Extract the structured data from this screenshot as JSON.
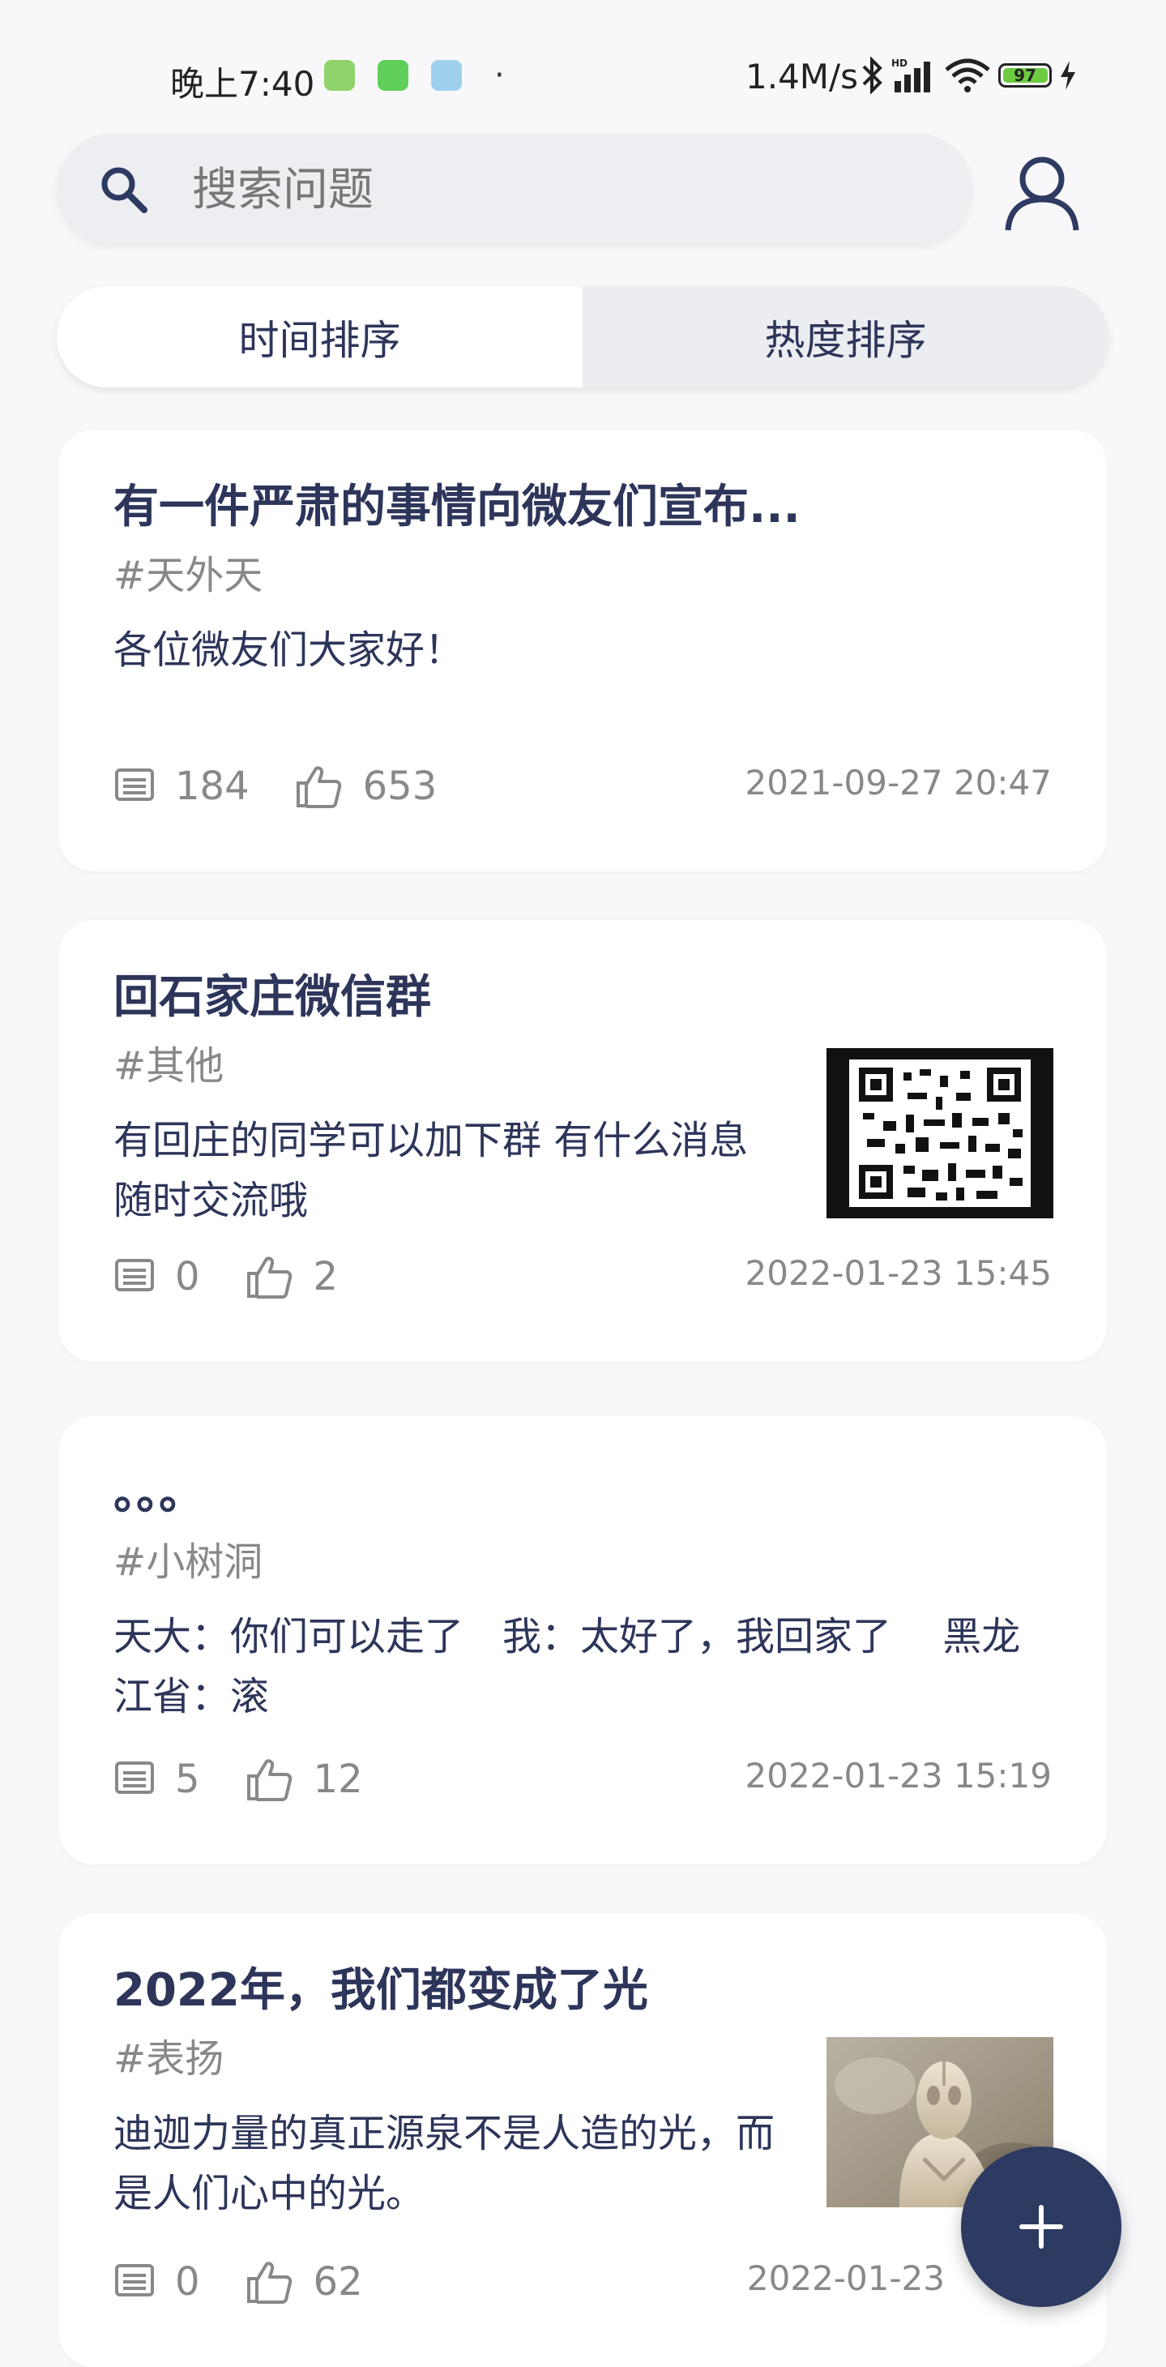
{
  "status_bar": {
    "time": "晚上7:40",
    "dot": "·",
    "net_speed": "1.4M/s",
    "battery": "97"
  },
  "search": {
    "placeholder": "搜索问题"
  },
  "sort_tabs": [
    {
      "label": "时间排序",
      "active": true
    },
    {
      "label": "热度排序",
      "active": false
    }
  ],
  "posts": [
    {
      "title": "有一件严肃的事情向微友们宣布...",
      "tag": "#天外天",
      "body": "各位微友们大家好！",
      "comments": "184",
      "likes": "653",
      "date": "2021-09-27  20:47"
    },
    {
      "title": "回石家庄微信群",
      "tag": "#其他",
      "body": "有回庄的同学可以加下群 有什么消息随时交流哦",
      "comments": "0",
      "likes": "2",
      "date": "2022-01-23  15:45",
      "thumbnail": "qr-code"
    },
    {
      "title": "。。。",
      "tag": "#小树洞",
      "body": "天大：你们可以走了　我：太好了，我回家了　 黑龙江省：滚",
      "comments": "5",
      "likes": "12",
      "date": "2022-01-23  15:19"
    },
    {
      "title": "2022年，我们都变成了光",
      "tag": "#表扬",
      "body": "迪迦力量的真正源泉不是人造的光，而是人们心中的光。",
      "comments": "0",
      "likes": "62",
      "date": "2022-01-23",
      "thumbnail": "photo-statue"
    }
  ],
  "colors": {
    "accent": "#2d3a62",
    "text": "#2d355a",
    "muted": "#888888",
    "background": "#f8f8fa"
  }
}
